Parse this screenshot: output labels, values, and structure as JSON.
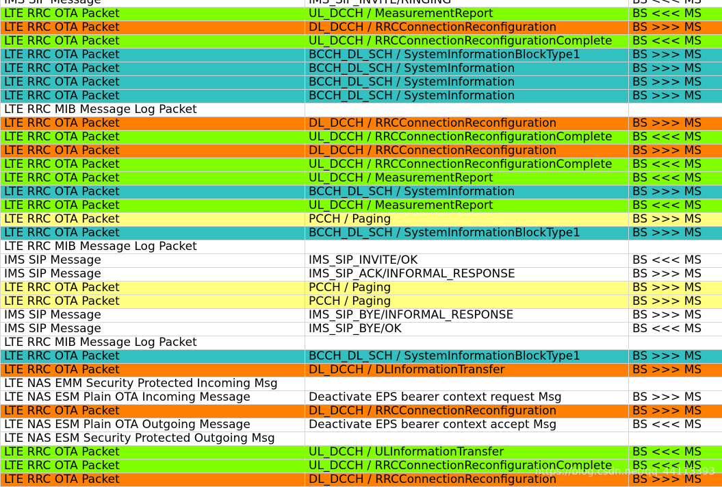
{
  "colors": {
    "green": "#80ff00",
    "orange": "#ff8000",
    "teal": "#33c0c0",
    "yellow": "#ffff80",
    "white": "#ffffff"
  },
  "rows": [
    {
      "type": "IMS SIP Message",
      "message": "IMS_SIP_INVITE/RINGING",
      "direction": "BS <<< MS",
      "color": "white"
    },
    {
      "type": "LTE RRC OTA Packet",
      "message": "UL_DCCH / MeasurementReport",
      "direction": "BS <<< MS",
      "color": "green"
    },
    {
      "type": "LTE RRC OTA Packet",
      "message": "DL_DCCH / RRCConnectionReconfiguration",
      "direction": "BS >>> MS",
      "color": "orange"
    },
    {
      "type": "LTE RRC OTA Packet",
      "message": "UL_DCCH / RRCConnectionReconfigurationComplete",
      "direction": "BS <<< MS",
      "color": "green"
    },
    {
      "type": "LTE RRC OTA Packet",
      "message": "BCCH_DL_SCH / SystemInformationBlockType1",
      "direction": "BS >>> MS",
      "color": "teal"
    },
    {
      "type": "LTE RRC OTA Packet",
      "message": "BCCH_DL_SCH / SystemInformation",
      "direction": "BS >>> MS",
      "color": "teal"
    },
    {
      "type": "LTE RRC OTA Packet",
      "message": "BCCH_DL_SCH / SystemInformation",
      "direction": "BS >>> MS",
      "color": "teal"
    },
    {
      "type": "LTE RRC OTA Packet",
      "message": "BCCH_DL_SCH / SystemInformation",
      "direction": "BS >>> MS",
      "color": "teal"
    },
    {
      "type": "LTE RRC MIB Message Log Packet",
      "message": "",
      "direction": "",
      "color": "white"
    },
    {
      "type": "LTE RRC OTA Packet",
      "message": "DL_DCCH / RRCConnectionReconfiguration",
      "direction": "BS >>> MS",
      "color": "orange"
    },
    {
      "type": "LTE RRC OTA Packet",
      "message": "UL_DCCH / RRCConnectionReconfigurationComplete",
      "direction": "BS <<< MS",
      "color": "green"
    },
    {
      "type": "LTE RRC OTA Packet",
      "message": "DL_DCCH / RRCConnectionReconfiguration",
      "direction": "BS >>> MS",
      "color": "orange"
    },
    {
      "type": "LTE RRC OTA Packet",
      "message": "UL_DCCH / RRCConnectionReconfigurationComplete",
      "direction": "BS <<< MS",
      "color": "green"
    },
    {
      "type": "LTE RRC OTA Packet",
      "message": "UL_DCCH / MeasurementReport",
      "direction": "BS <<< MS",
      "color": "green"
    },
    {
      "type": "LTE RRC OTA Packet",
      "message": "BCCH_DL_SCH / SystemInformation",
      "direction": "BS >>> MS",
      "color": "teal"
    },
    {
      "type": "LTE RRC OTA Packet",
      "message": "UL_DCCH / MeasurementReport",
      "direction": "BS <<< MS",
      "color": "green"
    },
    {
      "type": "LTE RRC OTA Packet",
      "message": "PCCH / Paging",
      "direction": "BS >>> MS",
      "color": "yellow"
    },
    {
      "type": "LTE RRC OTA Packet",
      "message": "BCCH_DL_SCH / SystemInformationBlockType1",
      "direction": "BS >>> MS",
      "color": "teal"
    },
    {
      "type": "LTE RRC MIB Message Log Packet",
      "message": "",
      "direction": "",
      "color": "white"
    },
    {
      "type": "IMS SIP Message",
      "message": "IMS_SIP_INVITE/OK",
      "direction": "BS <<< MS",
      "color": "white"
    },
    {
      "type": "IMS SIP Message",
      "message": "IMS_SIP_ACK/INFORMAL_RESPONSE",
      "direction": "BS >>> MS",
      "color": "white"
    },
    {
      "type": "LTE RRC OTA Packet",
      "message": "PCCH / Paging",
      "direction": "BS >>> MS",
      "color": "yellow"
    },
    {
      "type": "LTE RRC OTA Packet",
      "message": "PCCH / Paging",
      "direction": "BS >>> MS",
      "color": "yellow"
    },
    {
      "type": "IMS SIP Message",
      "message": "IMS_SIP_BYE/INFORMAL_RESPONSE",
      "direction": "BS >>> MS",
      "color": "white"
    },
    {
      "type": "IMS SIP Message",
      "message": "IMS_SIP_BYE/OK",
      "direction": "BS <<< MS",
      "color": "white"
    },
    {
      "type": "LTE RRC MIB Message Log Packet",
      "message": "",
      "direction": "",
      "color": "white"
    },
    {
      "type": "LTE RRC OTA Packet",
      "message": "BCCH_DL_SCH / SystemInformationBlockType1",
      "direction": "BS >>> MS",
      "color": "teal"
    },
    {
      "type": "LTE RRC OTA Packet",
      "message": "DL_DCCH / DLInformationTransfer",
      "direction": "BS >>> MS",
      "color": "orange"
    },
    {
      "type": "LTE NAS EMM Security Protected Incoming Msg",
      "message": "",
      "direction": "",
      "color": "white"
    },
    {
      "type": "LTE NAS ESM Plain OTA Incoming Message",
      "message": "Deactivate EPS bearer context request Msg",
      "direction": "BS >>> MS",
      "color": "white"
    },
    {
      "type": "LTE RRC OTA Packet",
      "message": "DL_DCCH / RRCConnectionReconfiguration",
      "direction": "BS >>> MS",
      "color": "orange"
    },
    {
      "type": "LTE NAS ESM Plain OTA Outgoing Message",
      "message": "Deactivate EPS bearer context accept Msg",
      "direction": "BS <<< MS",
      "color": "white"
    },
    {
      "type": "LTE NAS ESM Security Protected Outgoing Msg",
      "message": "",
      "direction": "",
      "color": "white"
    },
    {
      "type": "LTE RRC OTA Packet",
      "message": "UL_DCCH / ULInformationTransfer",
      "direction": "BS <<< MS",
      "color": "green"
    },
    {
      "type": "LTE RRC OTA Packet",
      "message": "UL_DCCH / RRCConnectionReconfigurationComplete",
      "direction": "BS <<< MS",
      "color": "green"
    },
    {
      "type": "LTE RRC OTA Packet",
      "message": "DL_DCCH / RRCConnectionReconfiguration",
      "direction": "BS >>> MS",
      "color": "orange"
    }
  ],
  "watermark": "https://blog.csdn.net/qq_44113393"
}
